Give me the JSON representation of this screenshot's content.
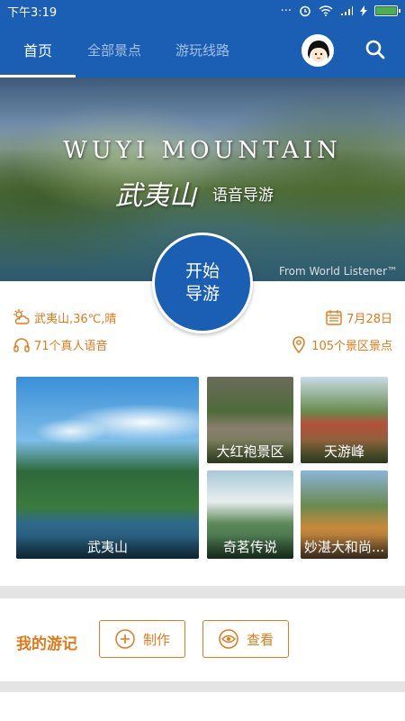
{
  "status_bar": {
    "time": "下午3:19"
  },
  "tabs": [
    {
      "label": "首页",
      "active": true
    },
    {
      "label": "全部景点",
      "active": false
    },
    {
      "label": "游玩线路",
      "active": false
    }
  ],
  "hero": {
    "title": "WUYI MOUNTAIN",
    "subtitle": "武夷山",
    "subtitle2": "语音导游",
    "credit": "From World Listener™"
  },
  "start_button": {
    "line1": "开始",
    "line2": "导游"
  },
  "info": {
    "weather": "武夷山,36℃,晴",
    "date": "7月28日",
    "voices": "71个真人语音",
    "spots": "105个景区景点"
  },
  "tiles": [
    {
      "label": "武夷山"
    },
    {
      "label": "大红袍景区"
    },
    {
      "label": "天游峰"
    },
    {
      "label": "奇茗传说"
    },
    {
      "label": "妙湛大和尚..."
    }
  ],
  "travel_notes": {
    "title": "我的游记",
    "make_label": "制作",
    "view_label": "查看"
  },
  "colors": {
    "primary": "#1a5fb4",
    "accent": "#e07a1a"
  }
}
